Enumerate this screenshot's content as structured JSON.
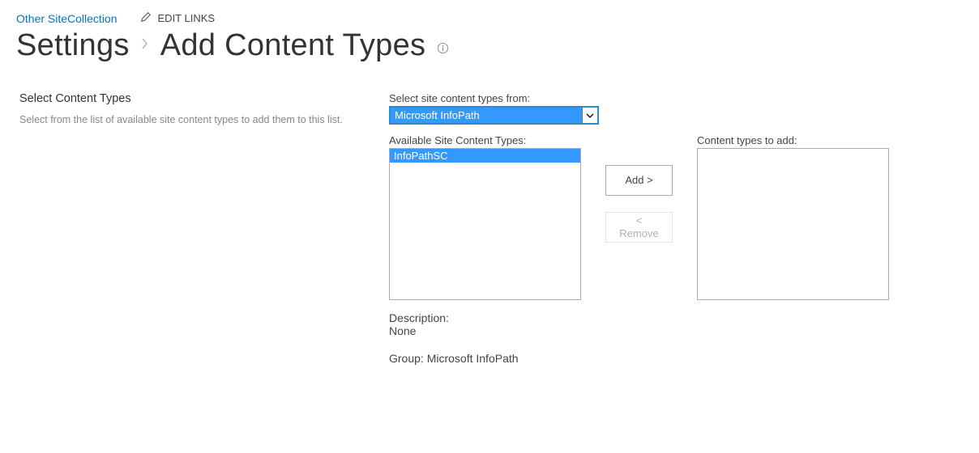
{
  "nav": {
    "site_link": "Other SiteCollection",
    "edit_links": "EDIT LINKS"
  },
  "breadcrumb": {
    "settings": "Settings",
    "page": "Add Content Types"
  },
  "section": {
    "title": "Select Content Types",
    "desc": "Select from the list of available site content types to add them to this list."
  },
  "form": {
    "select_from_label": "Select site content types from:",
    "select_from_value": "Microsoft InfoPath",
    "available_label": "Available Site Content Types:",
    "available_items": {
      "item0": "InfoPathSC"
    },
    "toadd_label": "Content types to add:",
    "add_button": "Add >",
    "remove_button_line1": "<",
    "remove_button_line2": "Remove",
    "description_label": "Description:",
    "description_value": "None",
    "group_label": "Group: ",
    "group_value": "Microsoft InfoPath"
  }
}
